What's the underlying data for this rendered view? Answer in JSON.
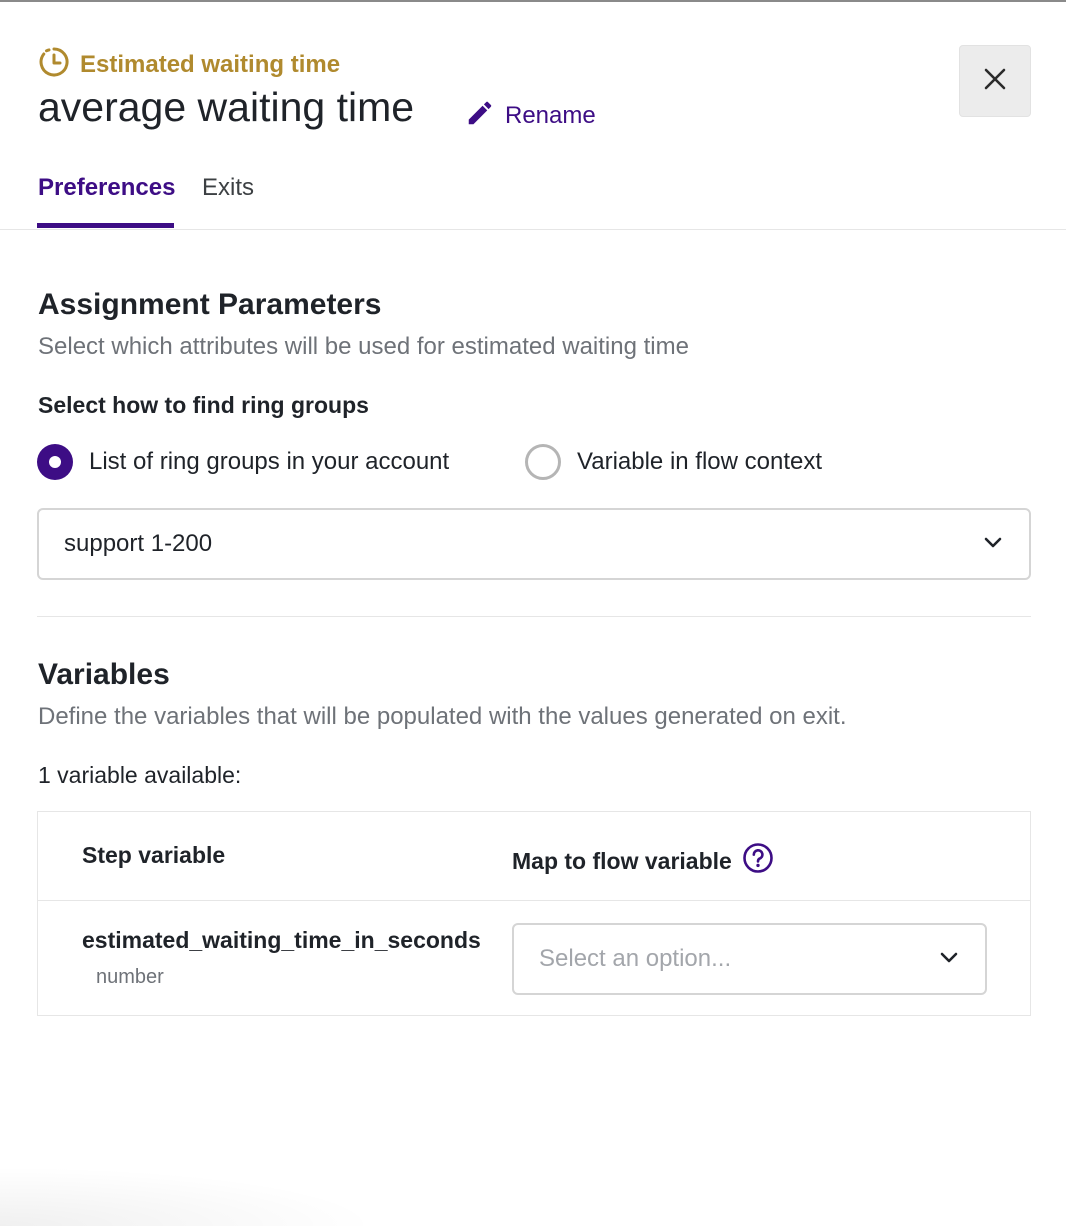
{
  "header": {
    "step_type": "Estimated waiting time",
    "title": "average waiting time",
    "rename_label": "Rename",
    "close_icon": "close-icon",
    "step_icon": "clock-icon",
    "rename_icon": "pencil-icon"
  },
  "tabs": [
    {
      "label": "Preferences",
      "active": true
    },
    {
      "label": "Exits",
      "active": false
    }
  ],
  "assignment": {
    "heading": "Assignment Parameters",
    "description": "Select which attributes will be used for estimated waiting time",
    "find_label": "Select how to find ring groups",
    "options": [
      {
        "label": "List of ring groups in your account",
        "selected": true
      },
      {
        "label": "Variable in flow context",
        "selected": false
      }
    ],
    "ring_group_value": "support 1-200"
  },
  "variables": {
    "heading": "Variables",
    "description": "Define the variables that will be populated with the values generated on exit.",
    "count_text": "1 variable available:",
    "columns": [
      "Step variable",
      "Map to flow variable"
    ],
    "rows": [
      {
        "name": "estimated_waiting_time_in_seconds",
        "type": "number",
        "placeholder": "Select an option..."
      }
    ]
  },
  "colors": {
    "accent": "#3d0d85",
    "step_type": "#b08a2e",
    "muted_text": "#6e7278"
  }
}
